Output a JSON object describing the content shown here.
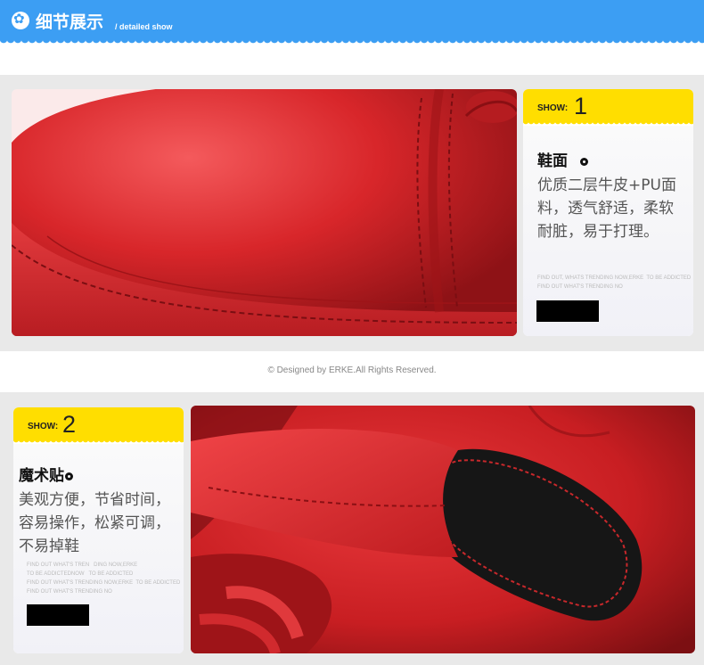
{
  "header": {
    "title": "细节展示",
    "subtitle": "/ detailed show",
    "icon": "flower-icon"
  },
  "sections": [
    {
      "show_label": "SHOW:",
      "number": "1",
      "heading": "鞋面",
      "description": "优质二层牛皮+PU面料，透气舒适，柔软耐脏，易于打理。",
      "small_text": "FIND OUT, WHATS TRENDING NOW,ERKE  TO BE ADDICTED\nFIND OUT WHAT'S TRENDING NO",
      "image": "red-leather-shoe-toe-closeup"
    },
    {
      "show_label": "SHOW:",
      "number": "2",
      "heading": "魔术贴",
      "description": "美观方便，节省时间，容易操作，松紧可调，不易掉鞋",
      "small_text": "FIND OUT WHAT'S TREN   DING NOW,ERKE\nTO BE ADDICTEDNOW   TO BE ADDICTED\nFIND OUT WHAT'S TRENDING NOW,ERKE  TO BE ADDICTED\nFIND OUT WHAT'S TRENDING NO",
      "image": "red-shoe-velcro-strap-closeup"
    }
  ],
  "footer": "©  Designed by ERKE.All Rights Reserved.",
  "colors": {
    "header_blue": "#3c9ef3",
    "tag_yellow": "#ffde00",
    "panel_gray": "#e9e9e9",
    "shoe_red": "#d8262a"
  }
}
